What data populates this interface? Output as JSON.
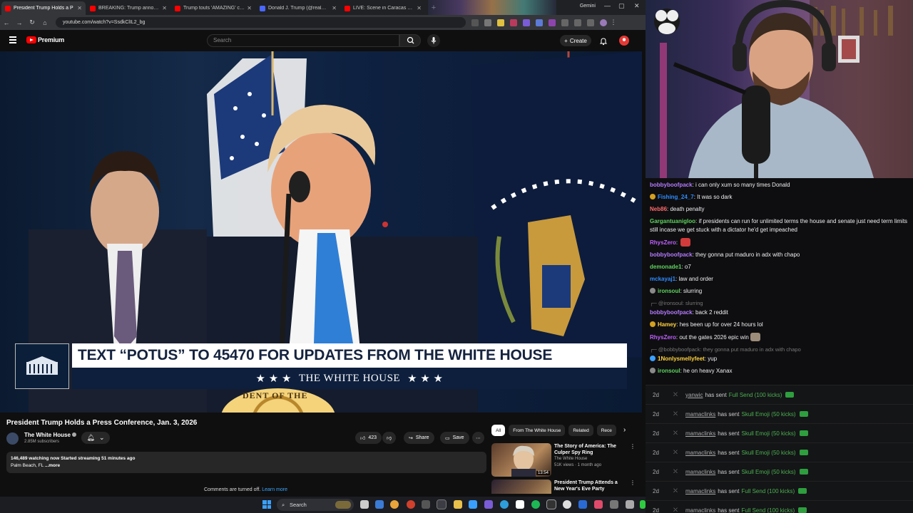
{
  "browser": {
    "tabs": [
      {
        "label": "President Trump Holds a P",
        "color": "#ff0000",
        "active": true
      },
      {
        "label": "BREAKING: Trump announces",
        "color": "#ff0000",
        "active": false
      },
      {
        "label": "Trump touts 'AMAZING' captur",
        "color": "#ff0000",
        "active": false
      },
      {
        "label": "Donald J. Trump (@realDon",
        "color": "#4a67ff",
        "active": false
      },
      {
        "label": "LIVE: Scene in Caracas after U",
        "color": "#ff0000",
        "active": false
      }
    ],
    "gemini_label": "Gemini",
    "url": "youtube.com/watch?v=SsdkClIL2_bg"
  },
  "youtube": {
    "brand": "Premium",
    "search_placeholder": "Search",
    "create_label": "Create",
    "video": {
      "lower_third_text": "TEXT “POTUS” TO 45470 FOR UPDATES FROM THE WHITE HOUSE",
      "lower_third_sub": "THE WHITE HOUSE",
      "stars": "★ ★ ★",
      "seal_text": "DENT OF THE"
    },
    "title": "President Trump Holds a Press Conference, Jan. 3, 2026",
    "channel": {
      "name": "The White House",
      "subscribers": "2.85M subscribers"
    },
    "actions": {
      "likes": "423",
      "share": "Share",
      "save": "Save",
      "more": "⋯"
    },
    "description": {
      "stats": "146,489 watching now  Started streaming 51 minutes ago",
      "location": "Palm Beach, FL",
      "more": "...more"
    },
    "comments_off": "Comments are turned off.",
    "learn_more": "Learn more",
    "chips": [
      "All",
      "From The White House",
      "Related",
      "Rece"
    ],
    "related": [
      {
        "title": "The Story of America: The Culper Spy Ring",
        "channel": "The White House",
        "meta": "51K views · 1 month ago",
        "duration": "13:54"
      },
      {
        "title": "President Trump Attends a New Year's Eve Party",
        "channel": "",
        "meta": "",
        "duration": ""
      }
    ]
  },
  "chat": [
    {
      "user": "bobbyboofpack",
      "color": "#b57bff",
      "text": "i can only xum so many times Donald",
      "badge": ""
    },
    {
      "user": "Fishing_24_7",
      "color": "#2e8bff",
      "text": "It was so dark",
      "badge": "#d4a020"
    },
    {
      "user": "Neb86",
      "color": "#ff6a6a",
      "text": "death penalty",
      "badge": ""
    },
    {
      "user": "Gargantuanigloo",
      "color": "#5fd35f",
      "text": "if presidents can run for unlimited terms the house and senate just need term limits still incase we get stuck with a dictator he'd get impeached",
      "badge": ""
    },
    {
      "user": "RhysZero",
      "color": "#c061ff",
      "text": "",
      "badge": "",
      "emote": "#d23b3b"
    },
    {
      "user": "bobbyboofpack",
      "color": "#b57bff",
      "text": "they gonna put maduro in adx with chapo",
      "badge": ""
    },
    {
      "user": "demonade1",
      "color": "#5fd35f",
      "text": "o7",
      "badge": ""
    },
    {
      "user": "mckayaj1",
      "color": "#2e8bff",
      "text": "law and order",
      "badge": ""
    },
    {
      "user": "ironsoul",
      "color": "#5fd35f",
      "text": "slurring",
      "badge": "#8a8a8a"
    },
    {
      "user": "bobbyboofpack",
      "color": "#b57bff",
      "text": "back 2 reddit",
      "badge": "",
      "reply": "@ironsoul: slurring"
    },
    {
      "user": "Hamey",
      "color": "#ffd23f",
      "text": "hes been up for over 24 hours lol",
      "badge": "#d4a020"
    },
    {
      "user": "RhysZero",
      "color": "#c061ff",
      "text": "out the gates 2026 epic win",
      "badge": "",
      "emote": "#9c8c7a"
    },
    {
      "user": "1Nonlysmellyfeet",
      "color": "#ffd23f",
      "text": "yup",
      "badge": "#3aa0ff",
      "reply": "@bobbyboofpack: they gonna put maduro in adx with chapo"
    },
    {
      "user": "ironsoul",
      "color": "#5fd35f",
      "text": "he on heavy Xanax",
      "badge": "#8a8a8a"
    }
  ],
  "feed": [
    {
      "age": "2d",
      "user": "yanwic",
      "verb": "has sent",
      "item": "Full Send (100 kicks)"
    },
    {
      "age": "2d",
      "user": "mamaclinks",
      "verb": "has sent",
      "item": "Skull Emoji (50 kicks)"
    },
    {
      "age": "2d",
      "user": "mamaclinks",
      "verb": "has sent",
      "item": "Skull Emoji (50 kicks)"
    },
    {
      "age": "2d",
      "user": "mamaclinks",
      "verb": "has sent",
      "item": "Skull Emoji (50 kicks)"
    },
    {
      "age": "2d",
      "user": "mamaclinks",
      "verb": "has sent",
      "item": "Skull Emoji (50 kicks)"
    },
    {
      "age": "2d",
      "user": "mamaclinks",
      "verb": "has sent",
      "item": "Full Send (100 kicks)"
    },
    {
      "age": "2d",
      "user": "mamaclinks",
      "verb": "has sent",
      "item": "Full Send (100 kicks)"
    }
  ],
  "taskbar": {
    "search_label": "Search"
  }
}
